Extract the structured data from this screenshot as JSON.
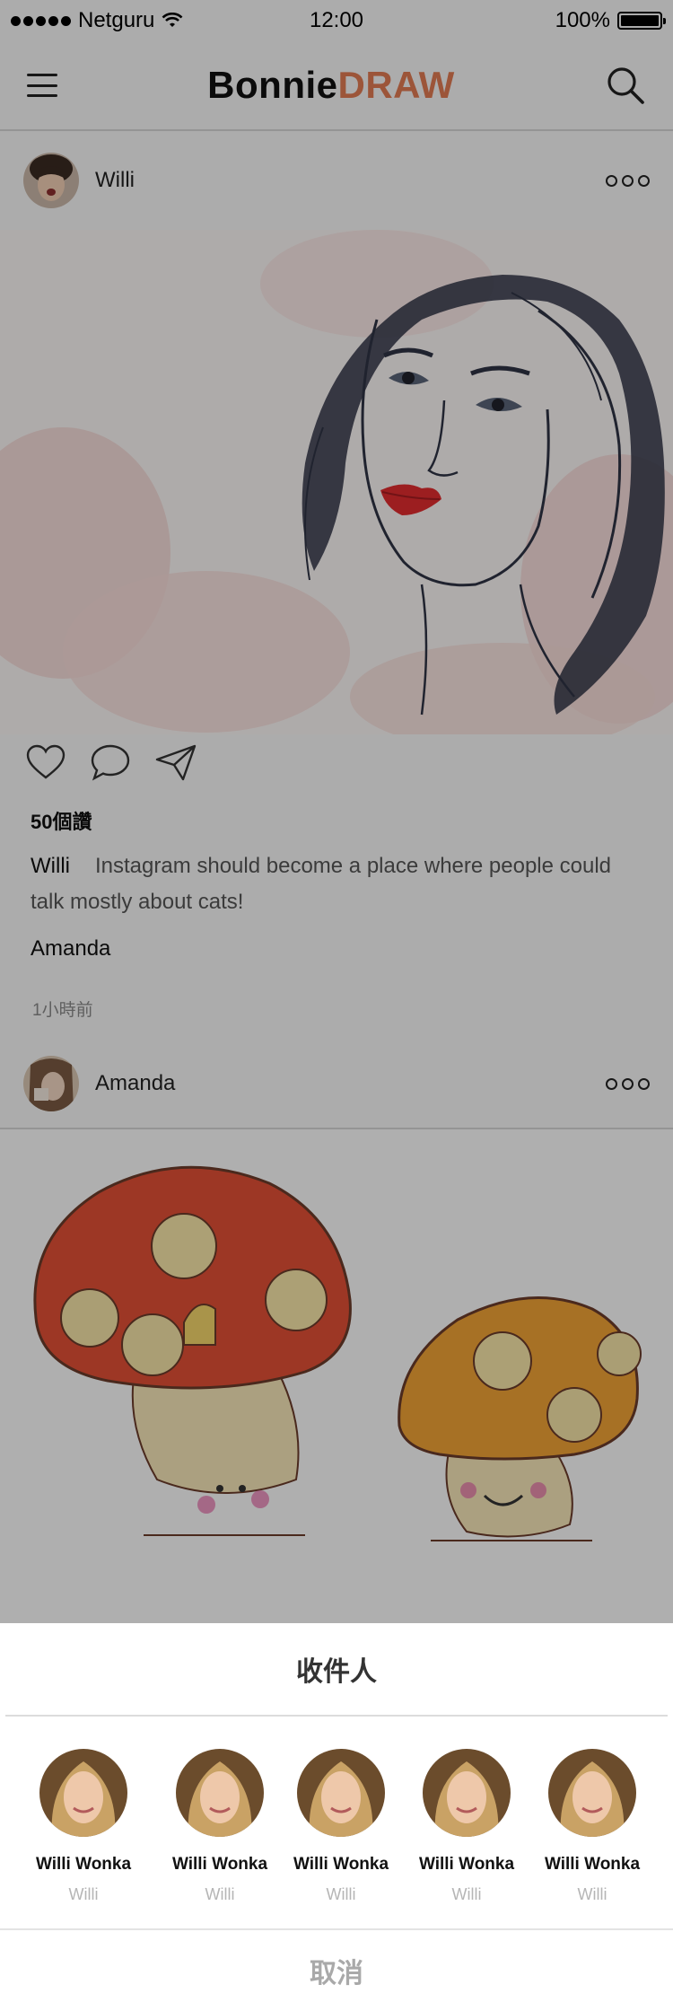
{
  "status_bar": {
    "carrier": "Netguru",
    "time": "12:00",
    "battery": "100%"
  },
  "nav": {
    "logo_part1": "Bonnie",
    "logo_part2": "DRAW",
    "brand_color": "#e07a52"
  },
  "posts": [
    {
      "user": "Willi",
      "likes": "50個讚",
      "caption_author": "Willi",
      "caption_text": "Instagram should become a place where people could talk mostly about cats!",
      "comment_user": "Amanda",
      "time_ago": "1小時前"
    },
    {
      "user": "Amanda"
    }
  ],
  "share_sheet": {
    "title": "收件人",
    "recipients": [
      {
        "name": "Willi Wonka",
        "handle": "Willi"
      },
      {
        "name": "Willi Wonka",
        "handle": "Willi"
      },
      {
        "name": "Willi Wonka",
        "handle": "Willi"
      },
      {
        "name": "Willi Wonka",
        "handle": "Willi"
      },
      {
        "name": "Willi Wonka",
        "handle": "Willi"
      }
    ],
    "cancel_label": "取消"
  },
  "icons": {
    "menu": "hamburger-menu-icon",
    "search": "search-icon",
    "more": "more-options-icon",
    "like": "heart-icon",
    "comment": "comment-icon",
    "share": "send-icon"
  }
}
